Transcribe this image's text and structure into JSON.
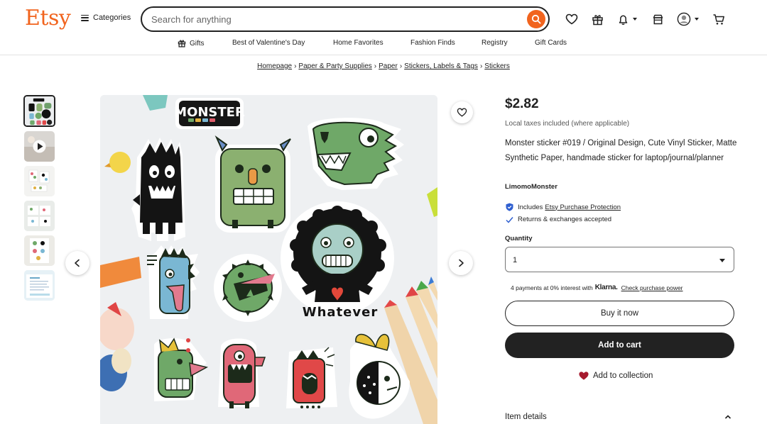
{
  "header": {
    "logo": "Etsy",
    "categories_label": "Categories",
    "search_placeholder": "Search for anything"
  },
  "subnav": [
    {
      "label": "Gifts",
      "icon": "gift-icon"
    },
    {
      "label": "Best of Valentine's Day"
    },
    {
      "label": "Home Favorites"
    },
    {
      "label": "Fashion Finds"
    },
    {
      "label": "Registry"
    },
    {
      "label": "Gift Cards"
    }
  ],
  "breadcrumb": [
    "Homepage",
    "Paper & Party Supplies",
    "Paper",
    "Stickers, Labels & Tags",
    "Stickers"
  ],
  "breadcrumb_separator": "›",
  "thumbnails_count": 6,
  "image": {
    "logo_text": "MONSTER",
    "caption": "Whatever"
  },
  "product": {
    "price": "$2.82",
    "tax_note": "Local taxes included (where applicable)",
    "title": "Monster sticker #019 / Original Design, Cute Vinyl Sticker, Matte Synthetic Paper, handmade sticker for laptop/journal/planner",
    "shop": "LimomoMonster",
    "protection_prefix": "Includes",
    "protection_link": "Etsy Purchase Protection",
    "returns": "Returns & exchanges accepted",
    "quantity_label": "Quantity",
    "quantity_value": "1",
    "klarna_prefix": "4 payments at 0% interest with",
    "klarna_brand": "Klarna.",
    "klarna_link": "Check purchase power",
    "buy_now": "Buy it now",
    "add_to_cart": "Add to cart",
    "add_to_collection": "Add to collection",
    "item_details": "Item details"
  },
  "colors": {
    "brand": "#f1641e",
    "dark": "#222222",
    "heart": "#a61a2e",
    "shield": "#2f5fd0"
  }
}
